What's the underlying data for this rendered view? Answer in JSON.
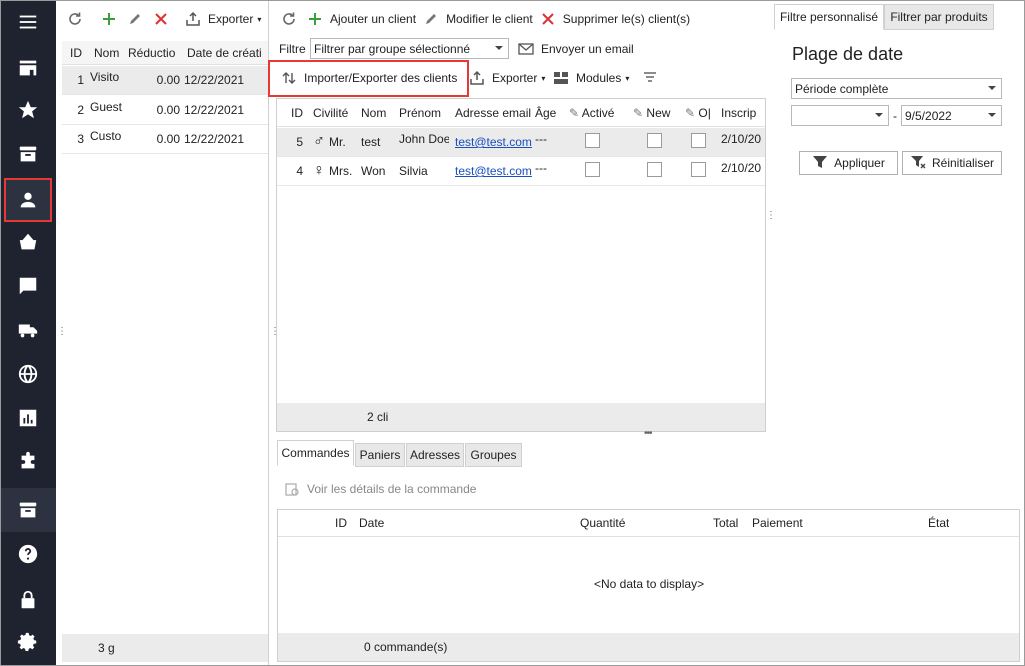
{
  "groups": {
    "toolbar": {
      "export_label": "Exporter"
    },
    "columns": [
      "ID",
      "Nom",
      "Réductio",
      "Date de créati"
    ],
    "rows": [
      {
        "id": "1",
        "name": "Visito",
        "discount": "0.00",
        "date": "12/22/2021"
      },
      {
        "id": "2",
        "name": "Guest",
        "discount": "0.00",
        "date": "12/22/2021"
      },
      {
        "id": "3",
        "name": "Custo",
        "discount": "0.00",
        "date": "12/22/2021"
      }
    ],
    "footer": "3 g"
  },
  "customers": {
    "toolbar": {
      "add": "Ajouter un client",
      "edit": "Modifier le client",
      "delete": "Supprimer le(s) client(s)"
    },
    "filter_label": "Filtre",
    "filter_value": "Filtrer par groupe sélectionné",
    "email_label": "Envoyer un email",
    "import_export_label": "Importer/Exporter des clients",
    "export_label": "Exporter",
    "modules_label": "Modules",
    "columns": [
      "ID",
      "Civilité",
      "Nom",
      "Prénom",
      "Adresse email",
      "Âge",
      "Activé",
      "New",
      "O|",
      "Inscrip"
    ],
    "rows": [
      {
        "id": "5",
        "civ": "Mr.",
        "nom": "test",
        "prenom": "John Doe",
        "email": "test@test.com",
        "age": "---",
        "date": "2/10/20"
      },
      {
        "id": "4",
        "civ": "Mrs.",
        "nom": "Won",
        "prenom": "Silvia",
        "email": "test@test.com",
        "age": "---",
        "date": "2/10/20"
      }
    ],
    "footer": "2 cli"
  },
  "orders": {
    "tabs": [
      "Commandes",
      "Paniers",
      "Adresses",
      "Groupes"
    ],
    "details_label": "Voir les détails de la commande",
    "columns": [
      "ID",
      "Date",
      "Quantité",
      "Total",
      "Paiement",
      "État"
    ],
    "empty_text": "<No data to display>",
    "footer": "0 commande(s)"
  },
  "filters": {
    "tabs": [
      "Filtre personnalisé",
      "Filtrer par produits"
    ],
    "title": "Plage de date",
    "period": "Période complète",
    "date_from": "",
    "date_separator": "-",
    "date_to": "9/5/2022",
    "apply": "Appliquer",
    "reset": "Réinitialiser"
  }
}
